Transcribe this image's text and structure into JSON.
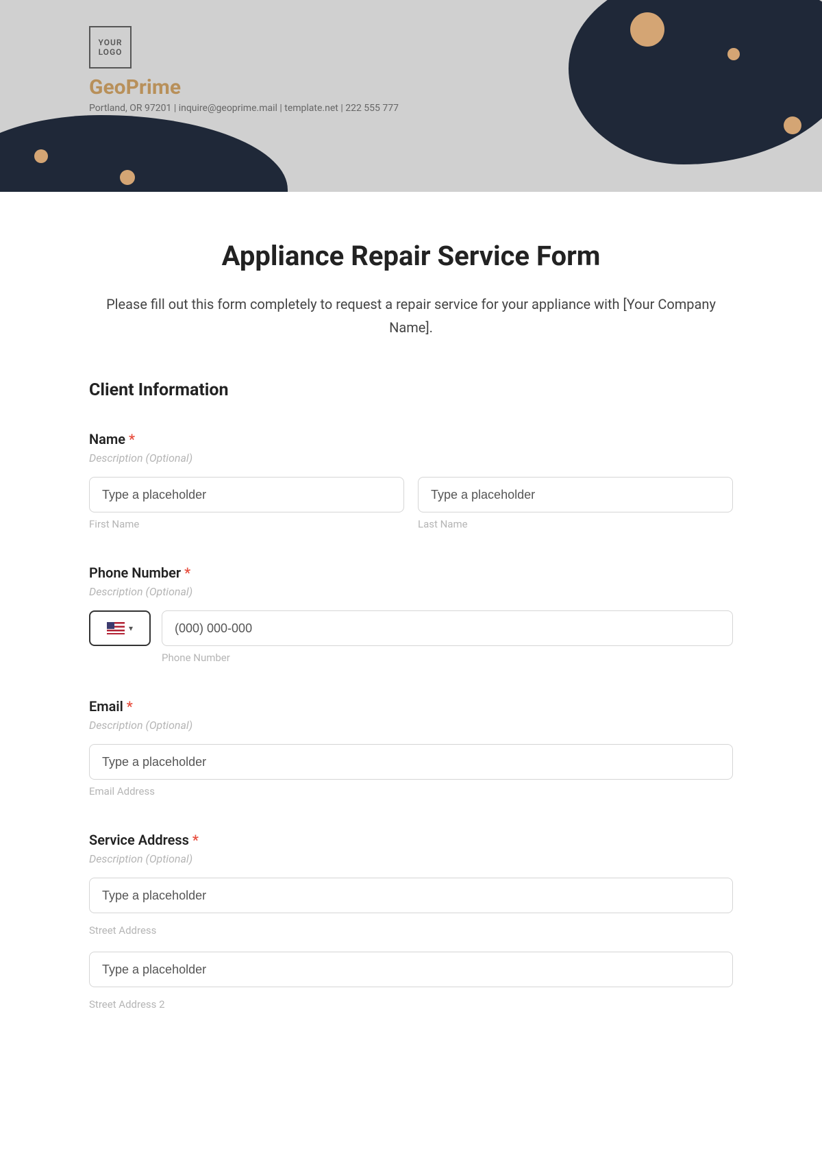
{
  "header": {
    "logo_text": "YOUR\nLOGO",
    "company_name": "GeoPrime",
    "company_info": "Portland, OR 97201 | inquire@geoprime.mail | template.net | 222 555 777"
  },
  "form": {
    "title": "Appliance Repair Service Form",
    "subtitle": "Please fill out this form completely to request a repair service for your appliance with [Your Company Name].",
    "section_heading": "Client Information",
    "name": {
      "label": "Name",
      "required": "*",
      "desc": "Description (Optional)",
      "first_placeholder": "Type a placeholder",
      "first_sublabel": "First Name",
      "last_placeholder": "Type a placeholder",
      "last_sublabel": "Last Name"
    },
    "phone": {
      "label": "Phone Number",
      "required": "*",
      "desc": "Description (Optional)",
      "placeholder": "(000) 000-000",
      "sublabel": "Phone Number"
    },
    "email": {
      "label": "Email",
      "required": "*",
      "desc": "Description (Optional)",
      "placeholder": "Type a placeholder",
      "sublabel": "Email Address"
    },
    "address": {
      "label": "Service Address",
      "required": "*",
      "desc": "Description (Optional)",
      "street1_placeholder": "Type a placeholder",
      "street1_sublabel": "Street Address",
      "street2_placeholder": "Type a placeholder",
      "street2_sublabel": "Street Address 2"
    }
  }
}
